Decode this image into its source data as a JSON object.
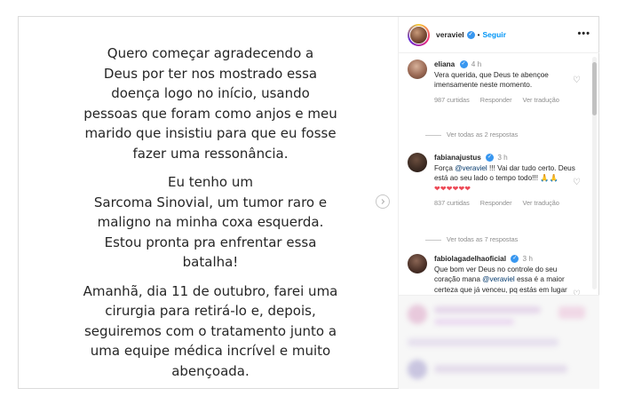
{
  "post": {
    "paragraphs": [
      [
        "Quero começar agradecendo a",
        "Deus por ter nos mostrado essa",
        "doença logo no início, usando",
        "pessoas que foram como anjos e meu",
        "marido que insistiu para que eu fosse",
        "fazer uma ressonância."
      ],
      [
        "Eu tenho um",
        "Sarcoma Sinovial, um tumor raro e",
        "maligno na minha coxa esquerda.",
        "Estou pronta pra enfrentar essa",
        "batalha!"
      ],
      [
        "Amanhã, dia 11 de outubro, farei uma",
        "cirurgia para retirá-lo e, depois,",
        "seguiremos com o tratamento junto a",
        "uma equipe médica incrível e muito",
        "abençoada."
      ]
    ]
  },
  "header": {
    "username": "veraviel",
    "separator": "•",
    "follow_label": "Seguir",
    "more_icon": "more-icon",
    "verified_icon": "verified-icon"
  },
  "comments": [
    {
      "username": "eliana",
      "verified": true,
      "time": "4 h",
      "text": "Vera querida, que Deus te abençoe imensamente neste momento.",
      "likes": "987 curtidas",
      "reply_label": "Responder",
      "translate_label": "Ver tradução",
      "view_replies": "Ver todas as 2 respostas"
    },
    {
      "username": "fabianajustus",
      "verified": true,
      "time": "3 h",
      "text_before": "Força ",
      "mention": "@veraviel",
      "text_after": " !!! Vai dar tudo certo. Deus está ao seu lado o tempo todo!!! 🙏🙏",
      "hearts": "❤❤❤❤❤❤",
      "likes": "837 curtidas",
      "reply_label": "Responder",
      "translate_label": "Ver tradução",
      "view_replies": "Ver todas as 7 respostas"
    },
    {
      "username": "fabiolagadelhaoficial",
      "verified": true,
      "time": "3 h",
      "text_before": "Que bom ver Deus no controle do seu coração mana ",
      "mention": "@veraviel",
      "text_after": " essa é a maior certeza que já venceu, pq estás em lugar seguro! Ele está"
    }
  ],
  "colors": {
    "accent": "#0095f6",
    "verified": "#3897f0",
    "heart_red": "#ed4956",
    "text": "#262626",
    "muted": "#8e8e8e"
  }
}
